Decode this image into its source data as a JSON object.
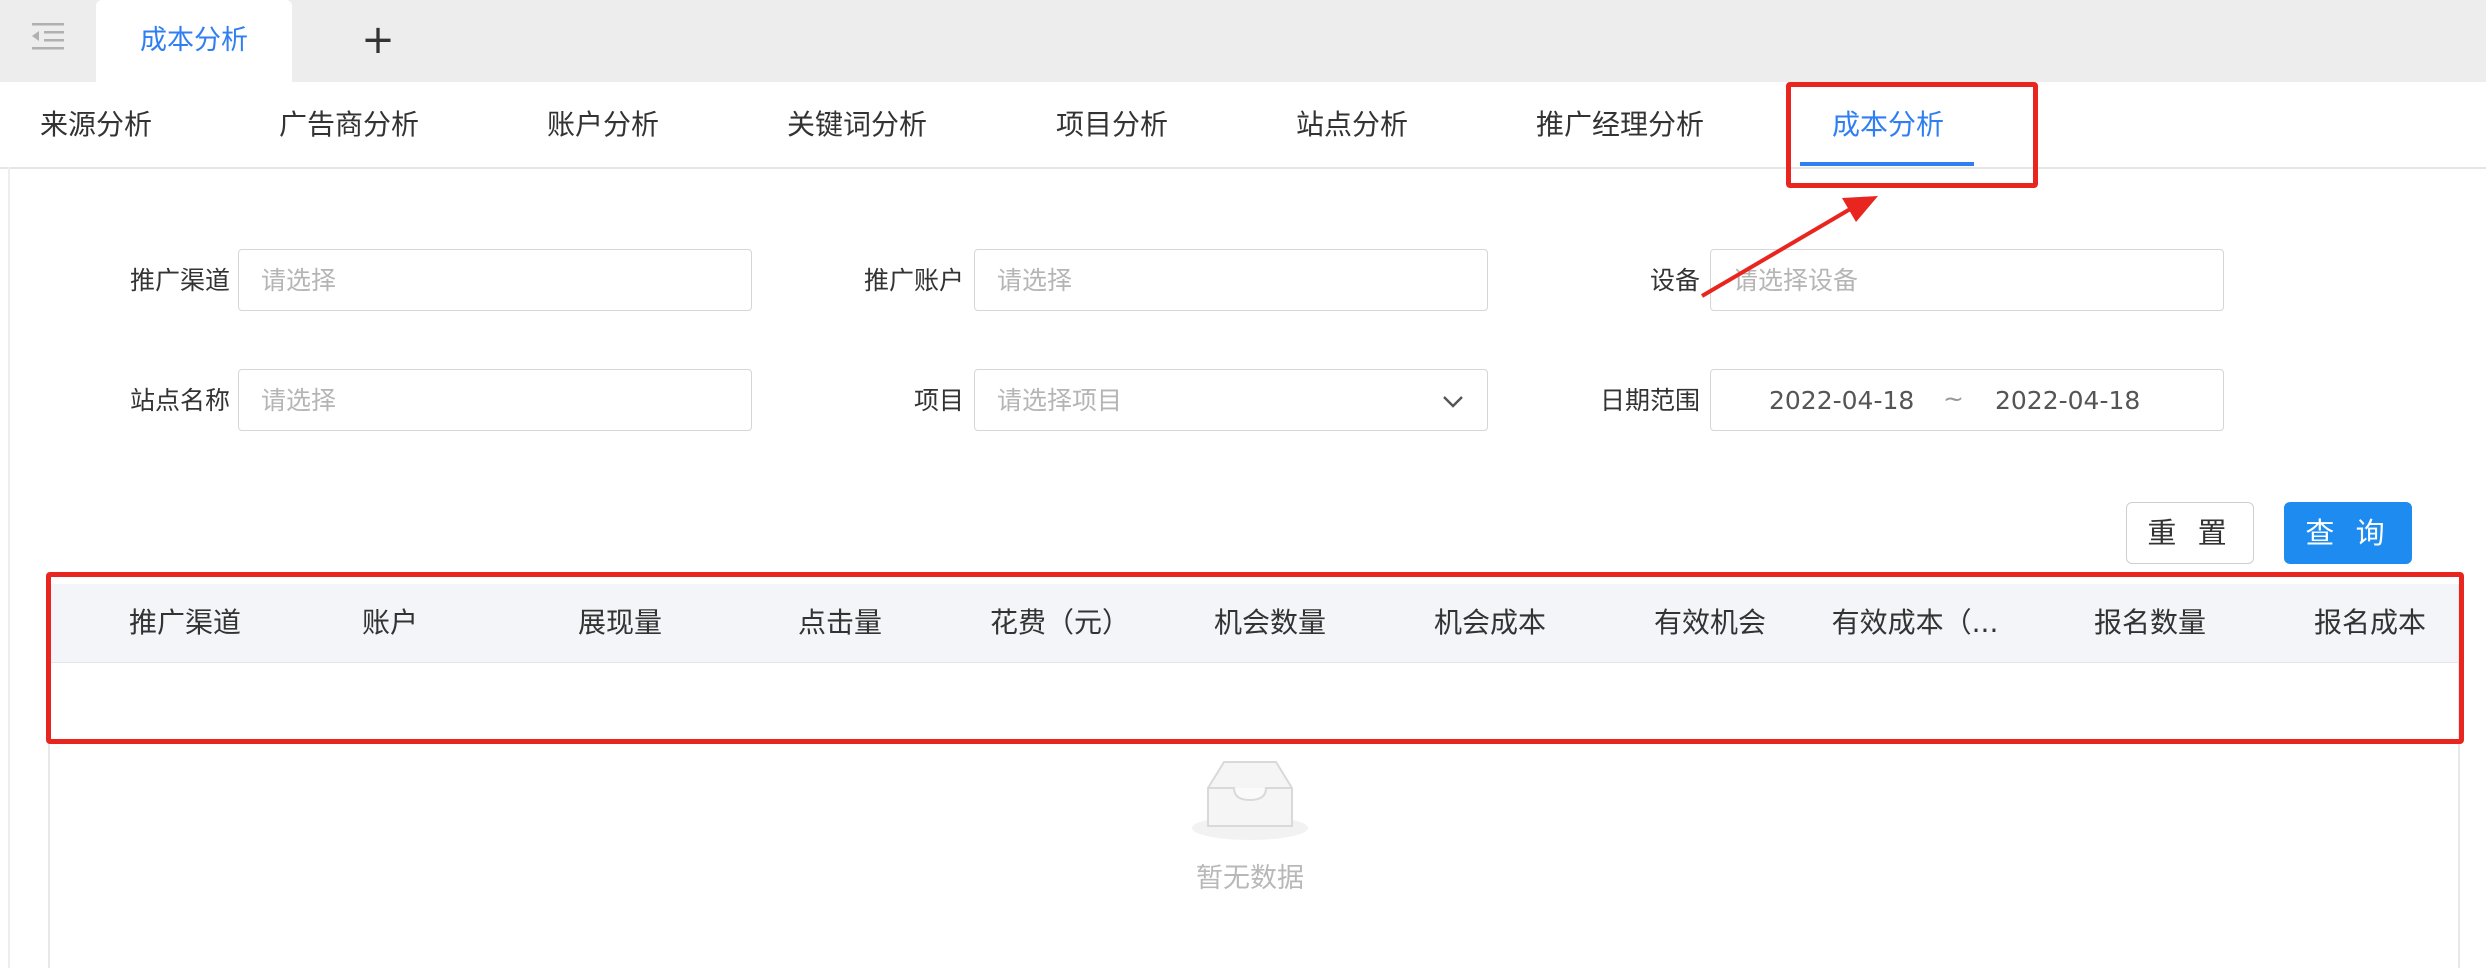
{
  "app": {
    "open_tab": "成本分析",
    "add_tab_symbol": "+"
  },
  "subtabs": [
    {
      "label": "来源分析"
    },
    {
      "label": "广告商分析"
    },
    {
      "label": "账户分析"
    },
    {
      "label": "关键词分析"
    },
    {
      "label": "项目分析"
    },
    {
      "label": "站点分析"
    },
    {
      "label": "推广经理分析"
    },
    {
      "label": "成本分析",
      "active": true
    }
  ],
  "filters": {
    "channel": {
      "label": "推广渠道",
      "placeholder": "请选择"
    },
    "account": {
      "label": "推广账户",
      "placeholder": "请选择"
    },
    "device": {
      "label": "设备",
      "placeholder": "请选择设备"
    },
    "site": {
      "label": "站点名称",
      "placeholder": "请选择"
    },
    "project": {
      "label": "项目",
      "placeholder": "请选择项目"
    },
    "date_range": {
      "label": "日期范围",
      "start": "2022-04-18",
      "separator": "~",
      "end": "2022-04-18"
    }
  },
  "buttons": {
    "reset": "重 置",
    "query": "查 询"
  },
  "table": {
    "columns": [
      "推广渠道",
      "账户",
      "展现量",
      "点击量",
      "花费（元）",
      "机会数量",
      "机会成本",
      "有效机会",
      "有效成本（...",
      "报名数量",
      "报名成本"
    ],
    "empty_text": "暂无数据"
  },
  "colors": {
    "accent": "#2f7ff2",
    "query_button": "#1e8bf0",
    "annotation": "#e8251f",
    "tab_bar": "#ededed"
  },
  "icons": {
    "menu_toggle": "menu-fold-icon",
    "project_dropdown": "chevron-down-icon",
    "empty_state": "inbox-icon"
  }
}
